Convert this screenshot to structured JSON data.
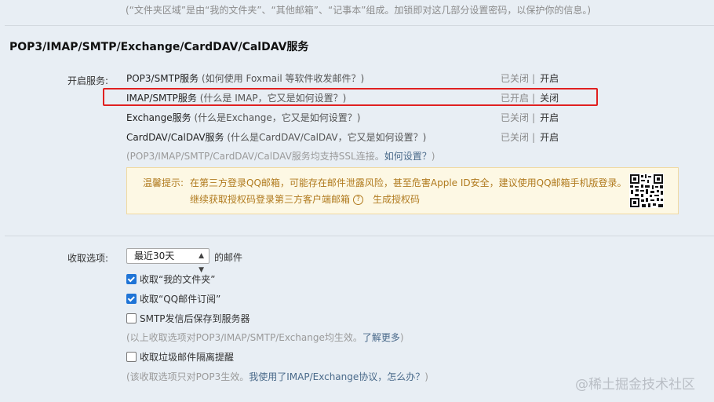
{
  "top_note": "(“文件夹区域”是由“我的文件夹”、“其他邮箱”、“记事本”组成。加锁即对这几部分设置密码，以保护你的信息。)",
  "section_title": "POP3/IMAP/SMTP/Exchange/CardDAV/CalDAV服务",
  "services": {
    "label": "开启服务:",
    "rows": [
      {
        "name": "POP3/SMTP服务",
        "help": "(如何使用 Foxmail 等软件收发邮件？)",
        "status": "已关闭",
        "action": "开启"
      },
      {
        "name": "IMAP/SMTP服务",
        "help": "(什么是 IMAP，它又是如何设置？)",
        "status": "已开启",
        "action": "关闭"
      },
      {
        "name": "Exchange服务",
        "help": "(什么是Exchange，它又是如何设置？)",
        "status": "已关闭",
        "action": "开启"
      },
      {
        "name": "CardDAV/CalDAV服务",
        "help": "(什么是CardDAV/CalDAV，它又是如何设置？)",
        "status": "已关闭",
        "action": "开启"
      }
    ],
    "separator": "|",
    "ssl_note_prefix": "(POP3/IMAP/SMTP/CardDAV/CalDAV服务均支持SSL连接。",
    "ssl_note_link": "如何设置？",
    "ssl_note_suffix": ")"
  },
  "tip": {
    "label": "温馨提示:",
    "line1": "在第三方登录QQ邮箱，可能存在邮件泄露风险，甚至危害Apple ID安全，建议使用QQ邮箱手机版登录。",
    "line2": "继续获取授权码登录第三方客户端邮箱",
    "help_glyph": "?",
    "link": "生成授权码"
  },
  "receive": {
    "label": "收取选项:",
    "select_value": "最近30天",
    "select_suffix": "的邮件",
    "options": [
      {
        "label": "收取“我的文件夹”",
        "checked": true
      },
      {
        "label": "收取“QQ邮件订阅”",
        "checked": true
      },
      {
        "label": "SMTP发信后保存到服务器",
        "checked": false
      }
    ],
    "note1_prefix": "(以上收取选项对POP3/IMAP/SMTP/Exchange均生效。",
    "note1_link": "了解更多",
    "note1_suffix": ")",
    "spam_option": {
      "label": "收取垃圾邮件隔离提醒",
      "checked": false
    },
    "note2_prefix": "(该收取选项只对POP3生效。",
    "note2_link": "我使用了IMAP/Exchange协议，怎么办？",
    "note2_suffix": ")"
  },
  "watermark": "@稀土掘金技术社区",
  "colors": {
    "highlight_border": "#e02020",
    "tip_bg": "#fdf8e4",
    "tip_text": "#b07a1e",
    "checkbox_checked": "#1f74d6"
  }
}
